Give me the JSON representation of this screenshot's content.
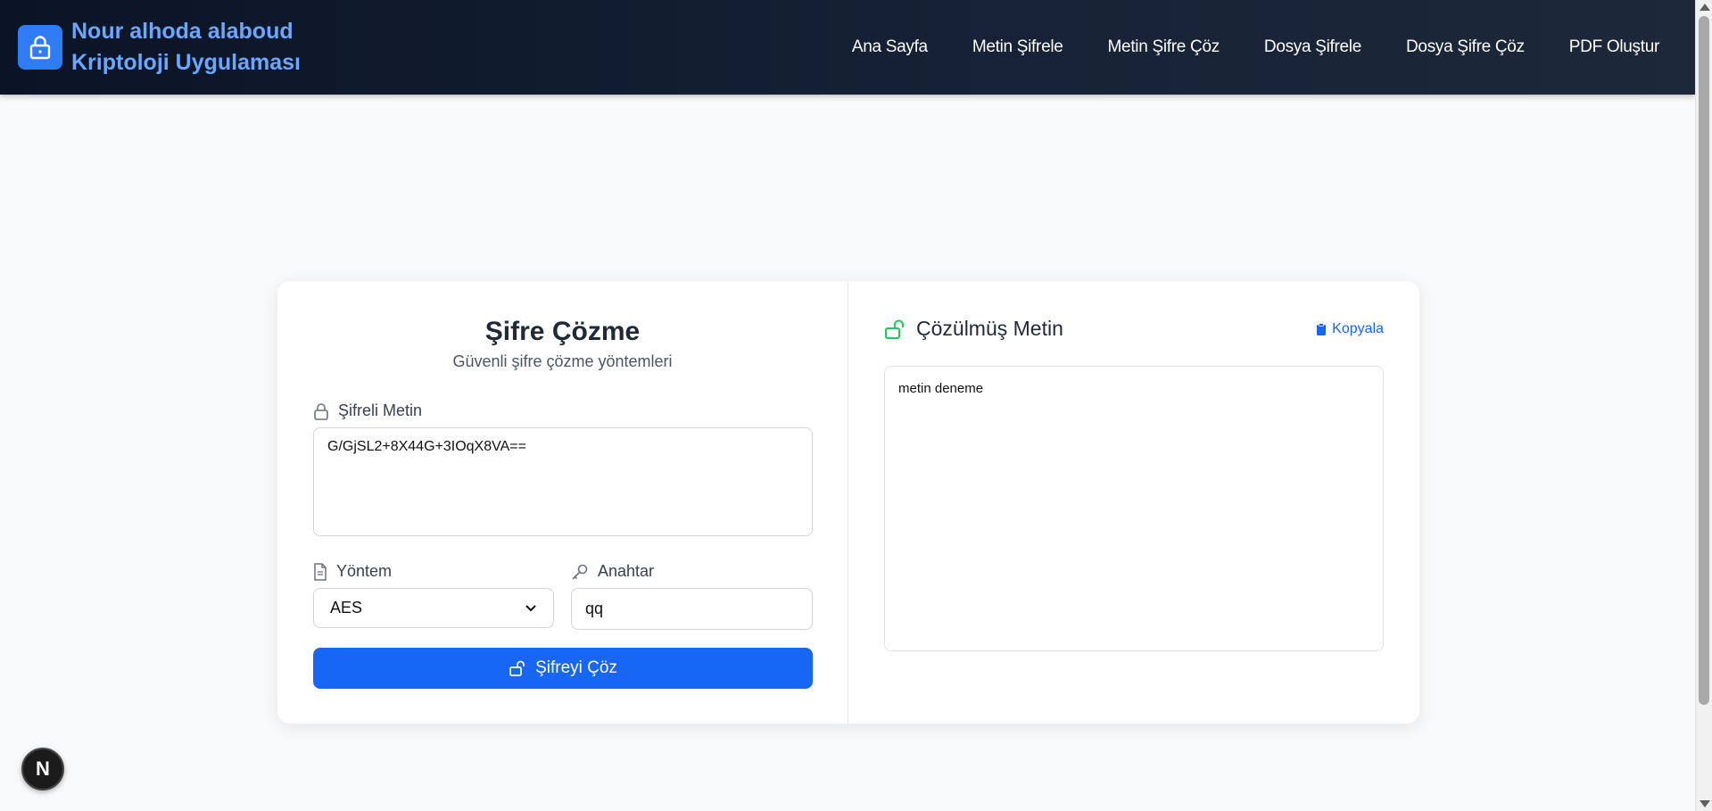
{
  "header": {
    "brand_line1": "Nour alhoda alaboud",
    "brand_line2": "Kriptoloji Uygulaması",
    "nav": [
      {
        "label": "Ana Sayfa"
      },
      {
        "label": "Metin Şifrele"
      },
      {
        "label": "Metin Şifre Çöz"
      },
      {
        "label": "Dosya Şifrele"
      },
      {
        "label": "Dosya Şifre Çöz"
      },
      {
        "label": "PDF Oluştur"
      }
    ]
  },
  "form": {
    "title": "Şifre Çözme",
    "subtitle": "Güvenli şifre çözme yöntemleri",
    "cipher_label": "Şifreli Metin",
    "cipher_value": "G/GjSL2+8X44G+3IOqX8VA==",
    "method_label": "Yöntem",
    "method_value": "AES",
    "key_label": "Anahtar",
    "key_value": "qq",
    "submit_label": "Şifreyi Çöz"
  },
  "result": {
    "title": "Çözülmüş Metin",
    "copy_label": "Kopyala",
    "output_text": "metin deneme"
  },
  "badge": {
    "letter": "N"
  },
  "colors": {
    "accent": "#1766f5",
    "brand_text": "#6aa8ff",
    "unlock_icon": "#22c55e",
    "header_bg": "#0b1426"
  }
}
